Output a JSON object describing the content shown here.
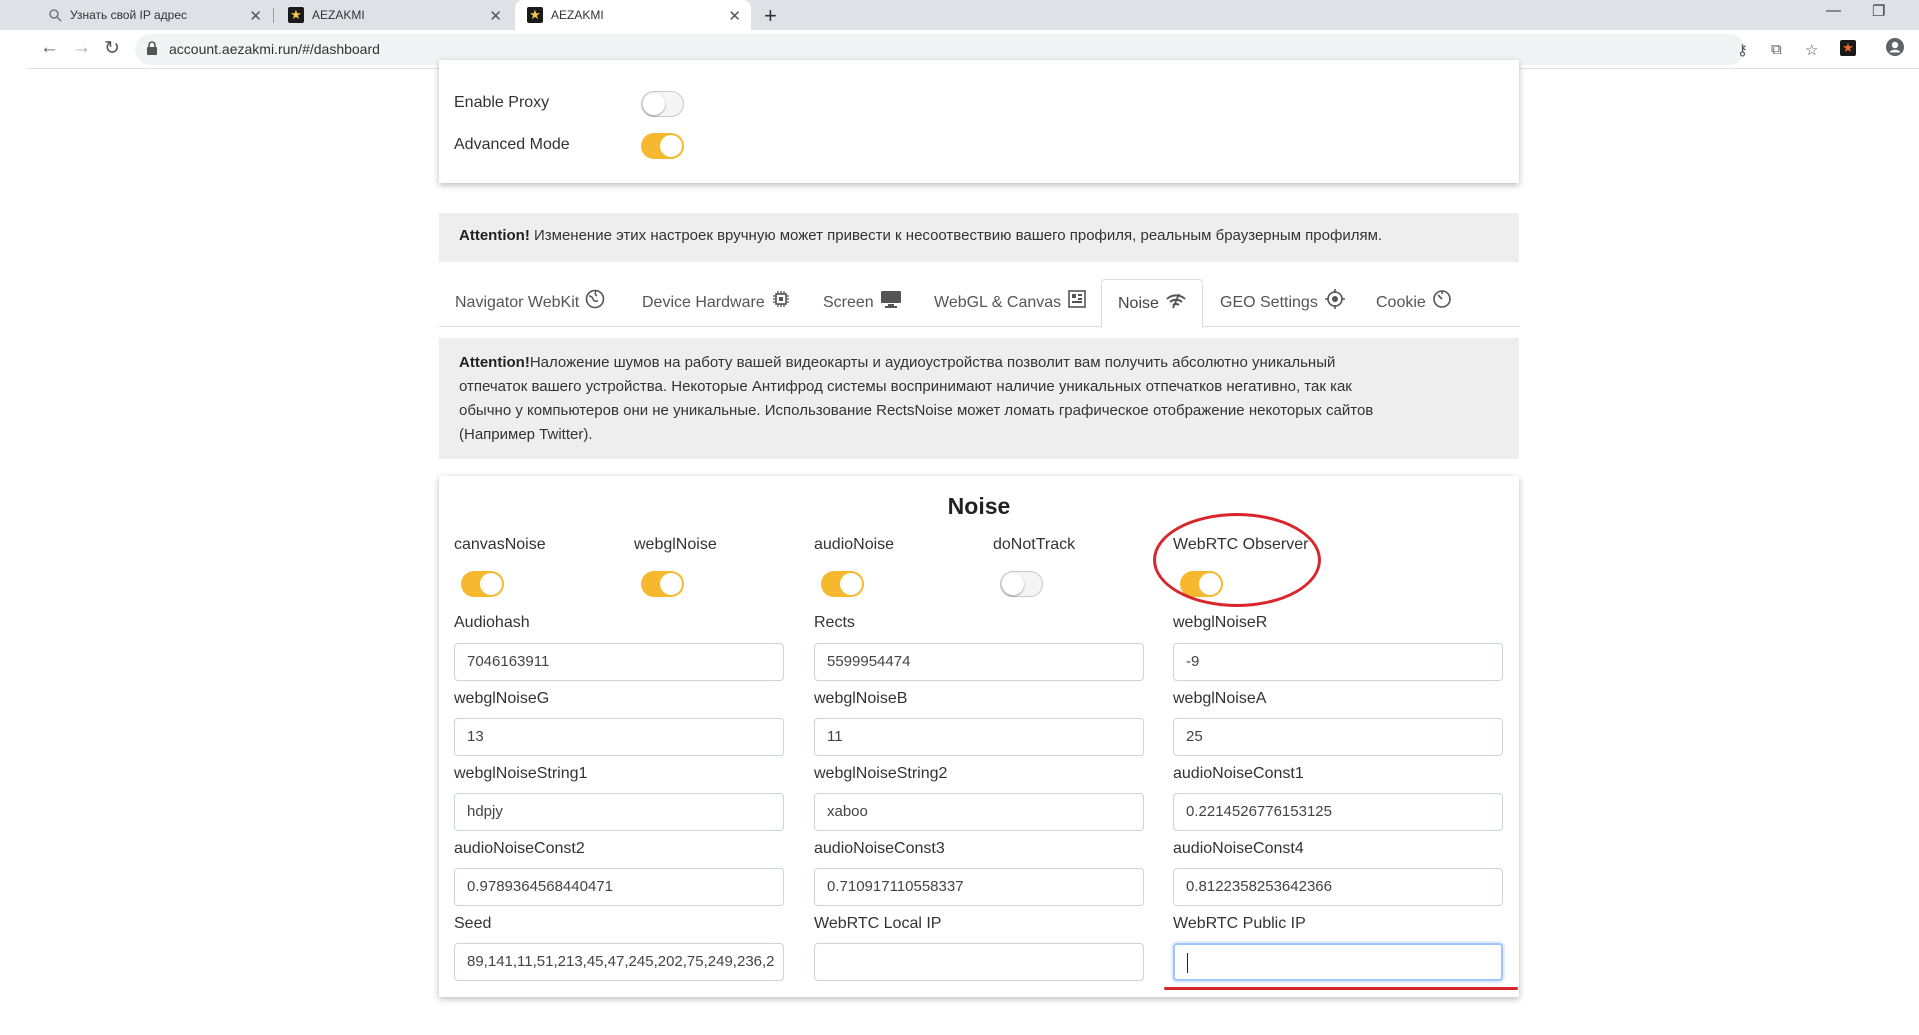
{
  "browser": {
    "tabs": [
      {
        "title": "Узнать свой IP адрес",
        "icon": "search-icon"
      },
      {
        "title": "AEZAKMI",
        "icon": "aezakmi-star-icon"
      },
      {
        "title": "AEZAKMI",
        "icon": "aezakmi-star-icon",
        "active": true
      }
    ],
    "url": "account.aezakmi.run/#/dashboard"
  },
  "top_settings": {
    "enable_proxy": {
      "label": "Enable Proxy",
      "on": false
    },
    "advanced_mode": {
      "label": "Advanced Mode",
      "on": true
    }
  },
  "attention1": {
    "prefix": "Attention!",
    "text": " Изменение этих настроек вручную может привести к несоотвествию вашего профиля, реальным браузерным профилям."
  },
  "nav_tabs": [
    {
      "label": "Navigator WebKit",
      "icon": "globe-icon"
    },
    {
      "label": "Device Hardware",
      "icon": "chip-icon"
    },
    {
      "label": "Screen",
      "icon": "monitor-icon"
    },
    {
      "label": "WebGL & Canvas",
      "icon": "grid-icon"
    },
    {
      "label": "Noise",
      "icon": "signal-icon",
      "active": true
    },
    {
      "label": "GEO Settings",
      "icon": "crosshair-icon"
    },
    {
      "label": "Cookie",
      "icon": "timer-icon"
    }
  ],
  "attention2": {
    "prefix": "Attention!",
    "lines": [
      "Наложение шумов на работу вашей видеокарты и аудиоустройства позволит вам получить абсолютно уникальный",
      "отпечаток вашего устройства. Некоторые Антифрод системы воспринимают наличие уникальных отпечатков негативно, так как",
      "обычно у компьютеров они не уникальные. Использование RectsNoise может ломать графическое отображение некоторых сайтов",
      "(Например Twitter)."
    ]
  },
  "noise": {
    "title": "Noise",
    "toggles": [
      {
        "label": "canvasNoise",
        "on": true
      },
      {
        "label": "webglNoise",
        "on": true
      },
      {
        "label": "audioNoise",
        "on": true
      },
      {
        "label": "doNotTrack",
        "on": false
      },
      {
        "label": "WebRTC Observer",
        "on": true
      }
    ],
    "fields": [
      {
        "label": "Audiohash",
        "value": "7046163911"
      },
      {
        "label": "Rects",
        "value": "5599954474"
      },
      {
        "label": "webglNoiseR",
        "value": "-9"
      },
      {
        "label": "webglNoiseG",
        "value": "13"
      },
      {
        "label": "webglNoiseB",
        "value": "11"
      },
      {
        "label": "webglNoiseA",
        "value": "25"
      },
      {
        "label": "webglNoiseString1",
        "value": "hdpjy"
      },
      {
        "label": "webglNoiseString2",
        "value": "xaboo"
      },
      {
        "label": "audioNoiseConst1",
        "value": "0.2214526776153125"
      },
      {
        "label": "audioNoiseConst2",
        "value": "0.9789364568440471"
      },
      {
        "label": "audioNoiseConst3",
        "value": "0.710917110558337"
      },
      {
        "label": "audioNoiseConst4",
        "value": "0.8122358253642366"
      },
      {
        "label": "Seed",
        "value": "89,141,11,51,213,45,47,245,202,75,249,236,2"
      },
      {
        "label": "WebRTC Local IP",
        "value": ""
      },
      {
        "label": "WebRTC Public IP",
        "value": "",
        "focused": true
      }
    ]
  },
  "colors": {
    "toggle_on": "#f5b82e",
    "annotation": "#d8262b"
  }
}
